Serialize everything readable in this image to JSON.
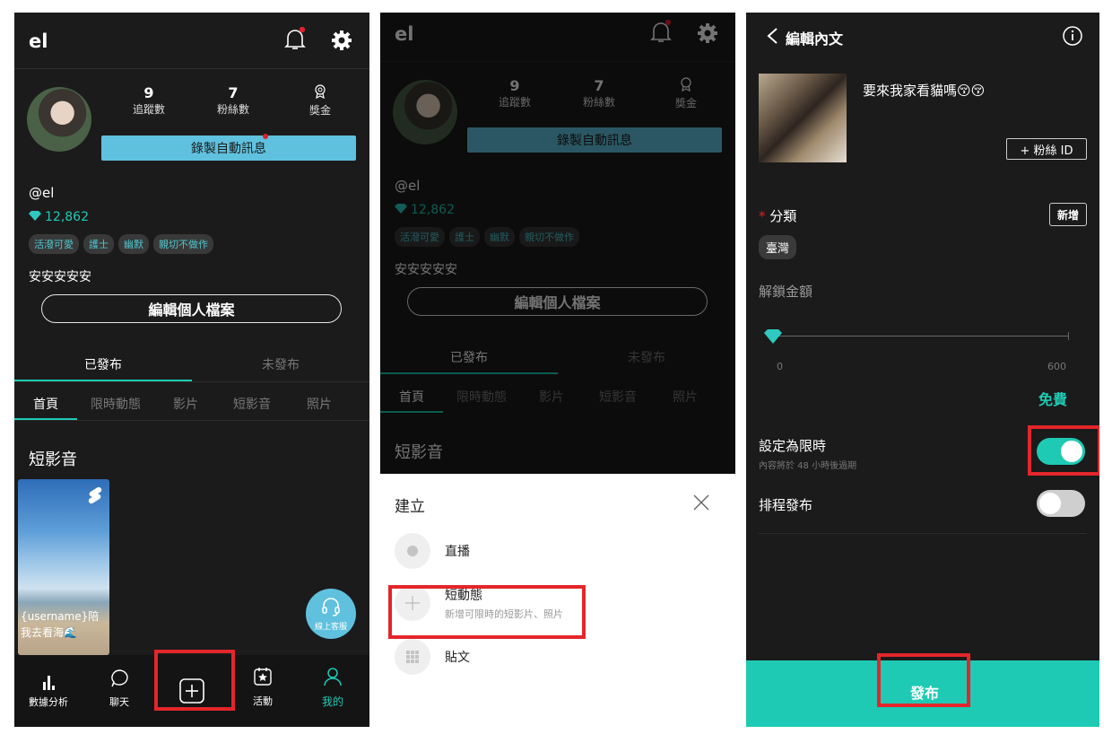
{
  "profile": {
    "app_logo": "el",
    "stats": [
      {
        "value": "9",
        "label": "追蹤數"
      },
      {
        "value": "7",
        "label": "粉絲數"
      },
      {
        "value": "",
        "label": "獎金"
      }
    ],
    "record_button": "錄製自動訊息",
    "handle": "@el",
    "diamonds": "12,862",
    "tags": [
      "活潑可愛",
      "護士",
      "幽默",
      "親切不做作"
    ],
    "bio": "安安安安安",
    "edit_button": "編輯個人檔案",
    "tabs": [
      "已發布",
      "未發布"
    ],
    "sub_tabs": [
      "首頁",
      "限時動態",
      "影片",
      "短影音",
      "照片"
    ],
    "section_title": "短影音",
    "card_caption": "{username}陪我去看海🌊",
    "support_label": "線上客服"
  },
  "bottom_nav": [
    {
      "label": "數據分析",
      "icon": "bar-chart-icon"
    },
    {
      "label": "聊天",
      "icon": "chat-bubble-icon"
    },
    {
      "label": "",
      "icon": "add-square-icon"
    },
    {
      "label": "活動",
      "icon": "calendar-star-icon"
    },
    {
      "label": "我的",
      "icon": "person-icon"
    }
  ],
  "create_sheet": {
    "title": "建立",
    "options": [
      {
        "label": "直播",
        "sub": "",
        "icon": "record-dot-icon"
      },
      {
        "label": "短動態",
        "sub": "新增可限時的短影片、照片",
        "icon": "plus-icon"
      },
      {
        "label": "貼文",
        "sub": "",
        "icon": "grid-icon"
      }
    ]
  },
  "edit_post": {
    "title": "編輯內文",
    "caption": "要來我家看貓嗎😚😚",
    "fan_id_button": "+ 粉絲 ID",
    "category_label": "分類",
    "add_button": "新增",
    "category_chip": "臺灣",
    "unlock_label": "解鎖金額",
    "slider_min": "0",
    "slider_max": "600",
    "slider_value": 0,
    "price_text": "免費",
    "limited_label": "設定為限時",
    "limited_desc": "內容將於 48 小時後過期",
    "limited_on": true,
    "schedule_label": "排程發布",
    "schedule_on": false,
    "publish_button": "發布"
  },
  "colors": {
    "teal": "#1ecab4",
    "record_blue": "#5fc1de",
    "highlight_red": "#e3262b",
    "notif_red": "#e0202a"
  }
}
